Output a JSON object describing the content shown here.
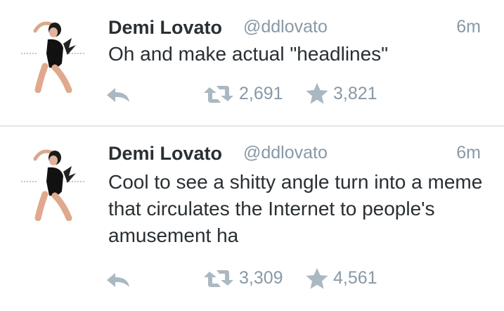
{
  "tweets": [
    {
      "author": {
        "name": "Demi Lovato",
        "handle": "@ddlovato",
        "avatar_icon": "avatar-photo"
      },
      "time": "6m",
      "text": "Oh and make actual \"headlines\"",
      "retweets": "2,691",
      "favorites": "3,821"
    },
    {
      "author": {
        "name": "Demi Lovato",
        "handle": "@ddlovato",
        "avatar_icon": "avatar-photo"
      },
      "time": "6m",
      "text": "Cool to see a shitty angle turn into a meme that circulates the Internet to people's amusement ha",
      "retweets": "3,309",
      "favorites": "4,561"
    }
  ],
  "colors": {
    "text": "#292f33",
    "muted": "#8899a6",
    "icon": "#aab8c2",
    "divider": "#e1e8ed"
  }
}
